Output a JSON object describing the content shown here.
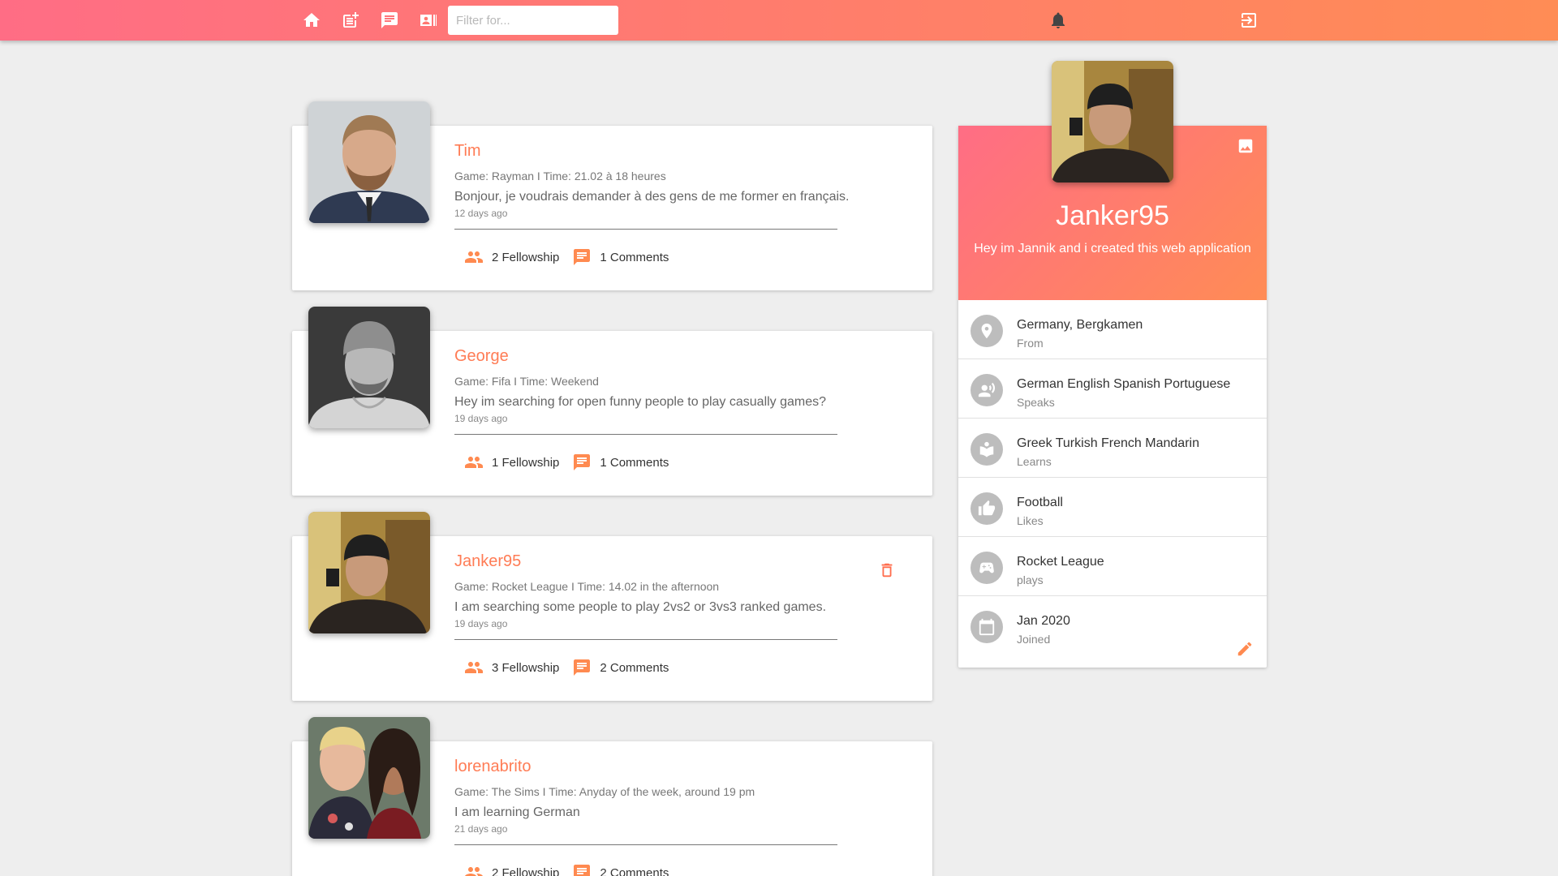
{
  "nav": {
    "filter_placeholder": "Filter for..."
  },
  "posts": [
    {
      "name": "Tim",
      "game": "Game: Rayman I Time: 21.02 à 18 heures",
      "text": "Bonjour, je voudrais demander à des gens de me former en français.",
      "time": "12 days ago",
      "fellowship": "2 Fellowship",
      "comments": "1 Comments",
      "avatar": "man-suit-beard"
    },
    {
      "name": "George",
      "game": "Game: Fifa I Time: Weekend",
      "text": "Hey im searching for open funny people to play casually games?",
      "time": "19 days ago",
      "fellowship": "1 Fellowship",
      "comments": "1 Comments",
      "avatar": "man-beanie-bw"
    },
    {
      "name": "Janker95",
      "game": "Game: Rocket League I Time: 14.02 in the afternoon",
      "text": "I am searching some people to play 2vs2 or 3vs3 ranked games.",
      "time": "19 days ago",
      "fellowship": "3 Fellowship",
      "comments": "2 Comments",
      "avatar": "man-cap-selfie"
    },
    {
      "name": "lorenabrito",
      "game": "Game: The Sims I Time: Anyday of the week, around 19 pm",
      "text": "I am learning German",
      "time": "21 days ago",
      "fellowship": "2 Fellowship",
      "comments": "2 Comments",
      "avatar": "couple-selfie"
    }
  ],
  "profile": {
    "name": "Janker95",
    "bio": "Hey im Jannik and i created this web application",
    "info": [
      {
        "icon": "location-icon",
        "title": "Germany, Bergkamen",
        "sub": "From"
      },
      {
        "icon": "speaker-icon",
        "title": "German English Spanish Portuguese",
        "sub": "Speaks"
      },
      {
        "icon": "book-icon",
        "title": "Greek Turkish French Mandarin",
        "sub": "Learns"
      },
      {
        "icon": "thumb-up-icon",
        "title": "Football",
        "sub": "Likes"
      },
      {
        "icon": "gamepad-icon",
        "title": "Rocket League",
        "sub": "plays"
      },
      {
        "icon": "calendar-icon",
        "title": "Jan 2020",
        "sub": "Joined"
      }
    ]
  },
  "colors": {
    "accent": "#ff7c55",
    "gradient_start": "#ff6d85",
    "gradient_end": "#ff8c55"
  }
}
